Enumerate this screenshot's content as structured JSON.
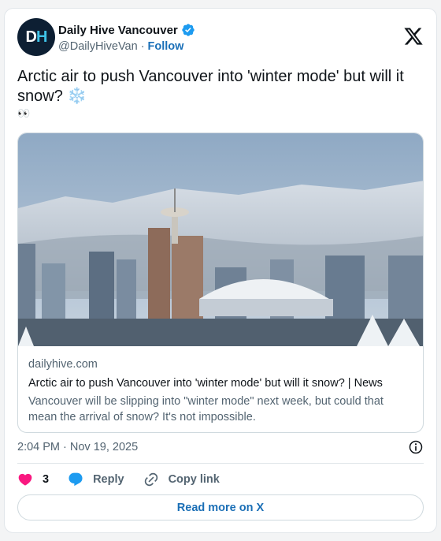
{
  "author": {
    "avatar_text_d": "D",
    "avatar_text_h": "H",
    "display_name": "Daily Hive Vancouver",
    "handle": "@DailyHiveVan",
    "separator": "·",
    "follow_label": "Follow",
    "verified": true
  },
  "tweet": {
    "text": "Arctic air to push Vancouver into 'winter mode' but will it snow? ❄️",
    "emoji_line": "👀"
  },
  "link_card": {
    "image_alt": "Vancouver skyline covered in snow",
    "domain": "dailyhive.com",
    "title": "Arctic air to push Vancouver into 'winter mode' but will it snow? | News",
    "description": "Vancouver will be slipping into \"winter mode\" next week, but could that mean the arrival of snow? It's not impossible."
  },
  "meta": {
    "timestamp": "2:04 PM · Nov 19, 2025"
  },
  "actions": {
    "like_count": "3",
    "reply_label": "Reply",
    "copy_link_label": "Copy link"
  },
  "read_more_label": "Read more on X",
  "colors": {
    "accent": "#1d9bf0",
    "like": "#f91880",
    "link": "#1b70b8",
    "muted": "#536471"
  },
  "icons": {
    "verified": "verified-badge-icon",
    "x_logo": "x-logo-icon",
    "info": "info-icon",
    "like": "heart-icon",
    "reply": "speech-bubble-icon",
    "copy_link": "link-icon"
  }
}
